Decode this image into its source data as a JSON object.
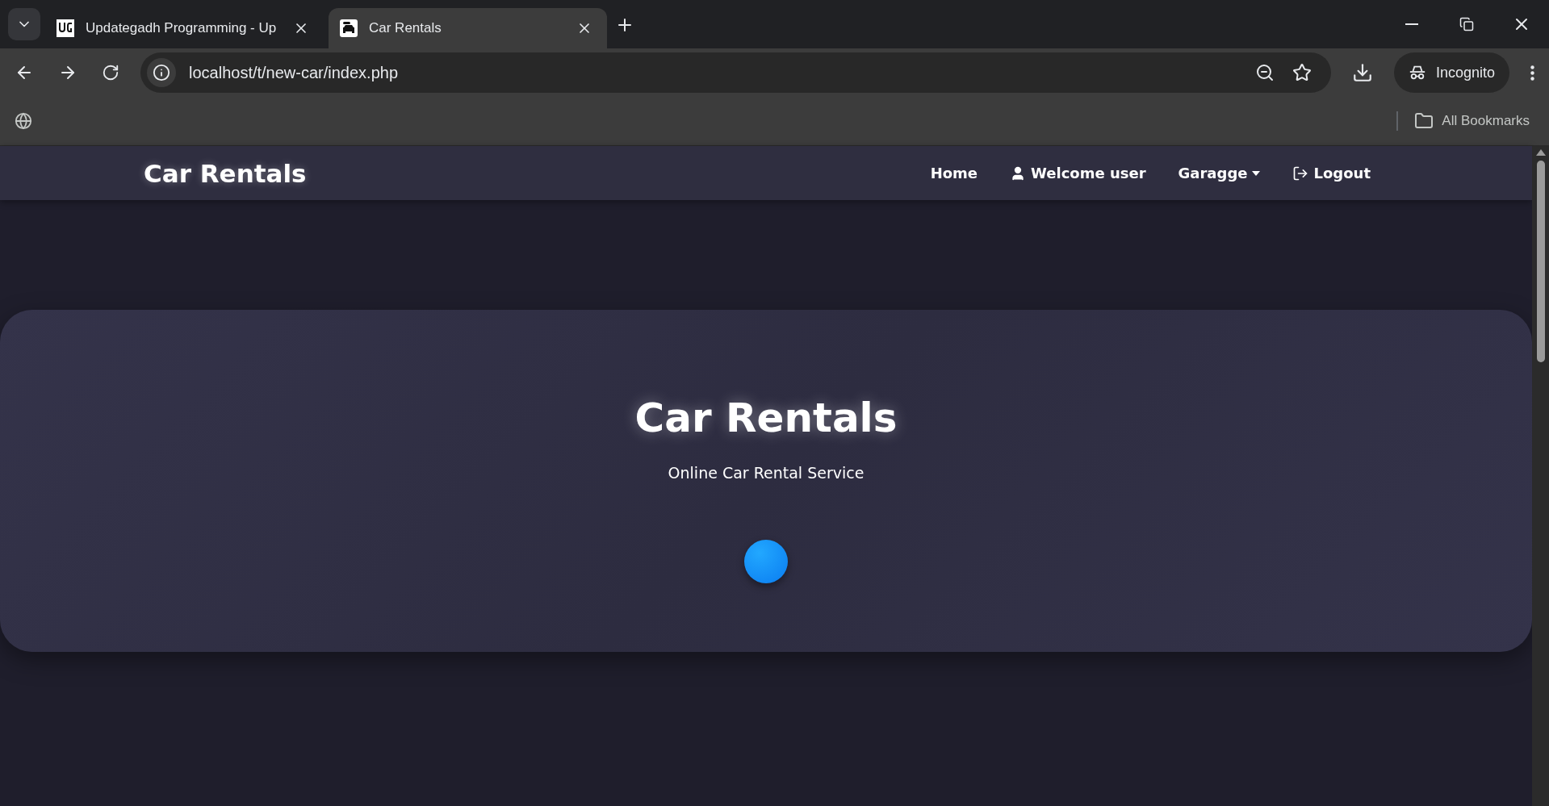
{
  "browser": {
    "tabs": [
      {
        "title": "Updategadh Programming - Up",
        "selected": false,
        "kind": "logo"
      },
      {
        "title": "Car Rentals",
        "selected": true,
        "kind": "car"
      }
    ],
    "address": "localhost/t/new-car/index.php",
    "profile": "Incognito",
    "bookmarks_label": "All Bookmarks"
  },
  "navbar": {
    "brand": "Car Rentals",
    "links": [
      {
        "label": "Home",
        "kind": "plain"
      },
      {
        "label": "Welcome user",
        "kind": "user"
      },
      {
        "label": "Garagge",
        "kind": "dropdown"
      },
      {
        "label": "Logout",
        "kind": "logout"
      }
    ]
  },
  "hero": {
    "title": "Car Rentals",
    "subtitle": "Online Car Rental Service"
  }
}
